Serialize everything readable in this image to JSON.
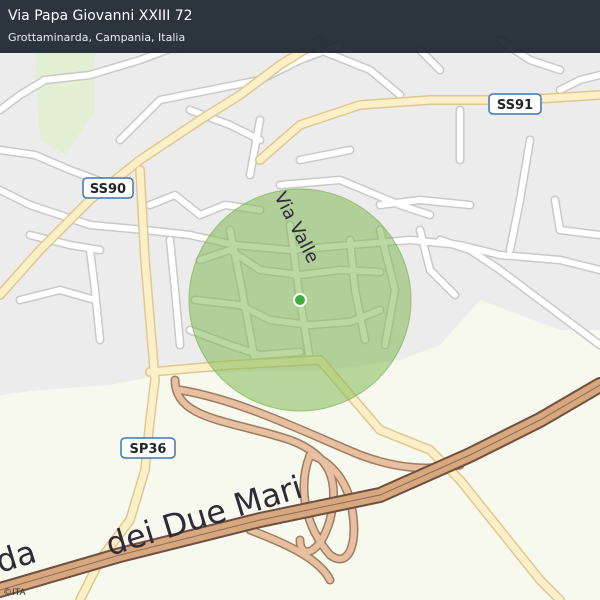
{
  "header": {
    "title": "Via Papa Giovanni XXIII 72",
    "subtitle": "Grottaminarda, Campania, Italia"
  },
  "map": {
    "streets": {
      "via_valle": "Via Valle",
      "highway": "dei  Due  Mari",
      "highway_partial": "da"
    },
    "shields": {
      "ss90": "SS90",
      "ss91": "SS91",
      "sp36": "SP36"
    },
    "attribution": "©ITA",
    "colors": {
      "background": "#f7f9ee",
      "urban": "#ececec",
      "road_minor": "#ffffff",
      "road_main_fill": "#fdf0c8",
      "road_main_casing": "#e2c68f",
      "highway_fill": "#d7a77e",
      "highway_casing": "#7b5a46",
      "accuracy_circle": "#8fbf60",
      "location_dot": "#3fae3a",
      "park": "#e4f0d4",
      "shield_border": "#3f74b8"
    }
  }
}
